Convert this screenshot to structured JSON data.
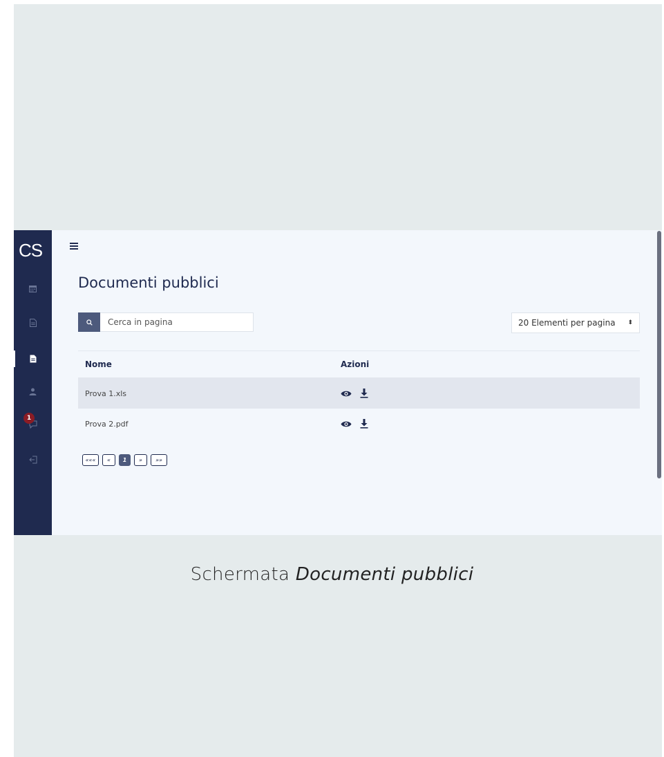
{
  "sidebar": {
    "logo": "CS",
    "badge_count": "1",
    "items": [
      {
        "name": "calendar-icon"
      },
      {
        "name": "document-icon"
      },
      {
        "name": "document-icon",
        "active": true
      },
      {
        "name": "user-icon"
      },
      {
        "name": "chat-icon"
      },
      {
        "name": "logout-icon"
      }
    ]
  },
  "header": {
    "menu_icon": "hamburger-icon"
  },
  "page": {
    "title": "Documenti pubblici"
  },
  "search": {
    "placeholder": "Cerca in pagina",
    "icon": "search-icon"
  },
  "per_page": {
    "selected": "20 Elementi per pagina",
    "caret": "⬍"
  },
  "table": {
    "headers": {
      "name": "Nome",
      "actions": "Azioni"
    },
    "rows": [
      {
        "name": "Prova 1.xls",
        "actions": [
          "view-icon",
          "download-icon"
        ]
      },
      {
        "name": "Prova 2.pdf",
        "actions": [
          "view-icon",
          "download-icon"
        ]
      }
    ]
  },
  "pagination": {
    "first": "«««",
    "prev": "«",
    "current": "1",
    "next": "»",
    "last": "»»"
  },
  "caption": {
    "prefix": "Schermata ",
    "emphasis": "Documenti pubblici"
  },
  "colors": {
    "sidebar": "#1f2a4f",
    "accent": "#4d5a7c",
    "background": "#f3f7fc",
    "badge": "#8b1c25"
  }
}
